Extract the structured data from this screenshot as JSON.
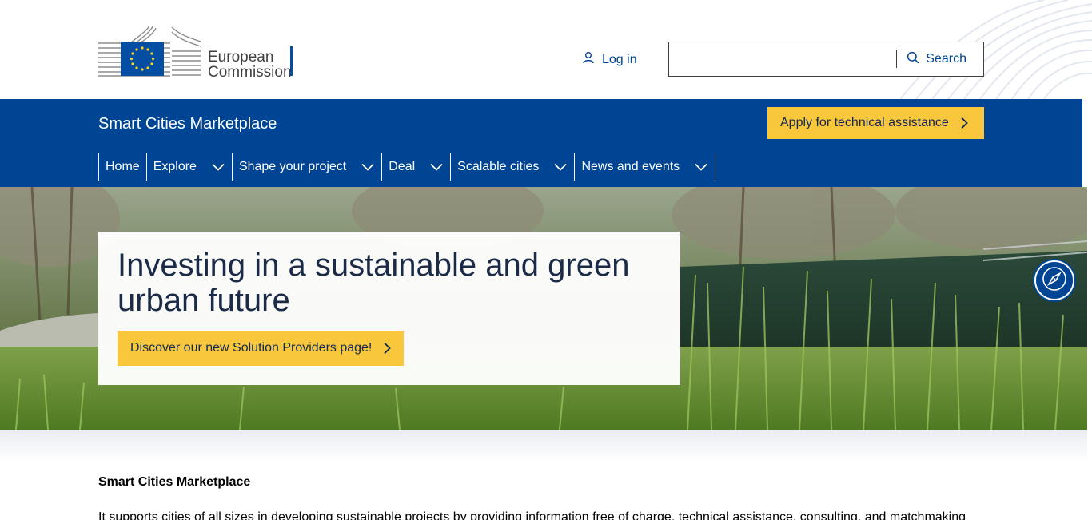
{
  "header": {
    "logo_text_line1": "European",
    "logo_text_line2": "Commission",
    "login_label": "Log in",
    "search": {
      "value": "",
      "placeholder": "",
      "button_label": "Search"
    }
  },
  "site": {
    "title": "Smart Cities Marketplace",
    "apply_label": "Apply for technical assistance"
  },
  "nav": {
    "items": [
      {
        "label": "Home",
        "has_dropdown": false
      },
      {
        "label": "Explore",
        "has_dropdown": true
      },
      {
        "label": "Shape your project",
        "has_dropdown": true
      },
      {
        "label": "Deal",
        "has_dropdown": true
      },
      {
        "label": "Scalable cities",
        "has_dropdown": true
      },
      {
        "label": "News and events",
        "has_dropdown": true
      }
    ]
  },
  "hero": {
    "title": "Investing in a sustainable and green urban future",
    "cta_label": "Discover our new Solution Providers page!"
  },
  "content": {
    "heading": "Smart Cities Marketplace",
    "intro": "It supports cities of all sizes in developing sustainable projects by providing information free of charge, technical assistance, consulting, and matchmaking"
  },
  "icons": {
    "login": "user-icon",
    "search": "search-icon",
    "apply": "chevron-right-icon",
    "nav_dropdown": "chevron-down-icon",
    "compass": "compass-icon"
  },
  "colors": {
    "brand_blue": "#004494",
    "accent_yellow": "#f9c73b",
    "eu_flag_blue": "#034ea2",
    "eu_star_yellow": "#ffd617"
  }
}
